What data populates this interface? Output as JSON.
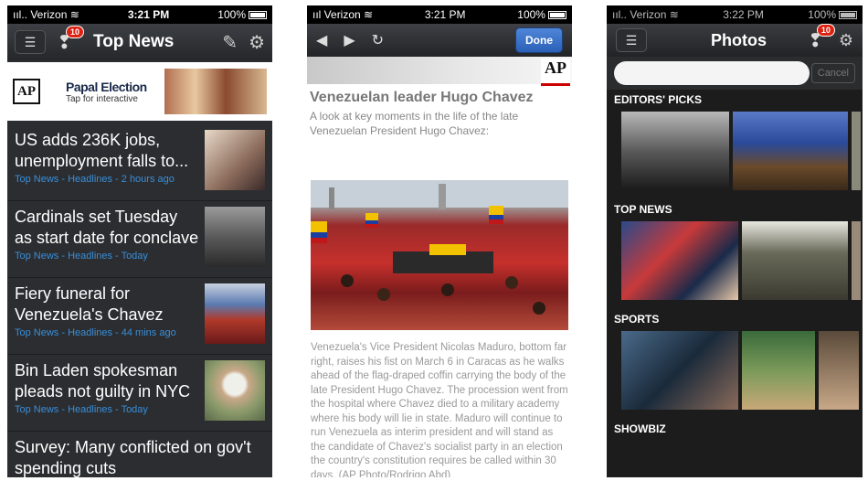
{
  "status": {
    "carrier": "Verizon",
    "time": "3:21 PM",
    "time3": "3:22 PM",
    "battery": "100%"
  },
  "news": {
    "title": "Top News",
    "badge": "10",
    "banner": {
      "logo": "AP",
      "title": "Papal Election",
      "subtitle": "Tap for interactive"
    },
    "stories": [
      {
        "headline": "US adds 236K jobs, unemployment falls to...",
        "meta": "Top News - Headlines - 2 hours ago"
      },
      {
        "headline": "Cardinals set Tuesday as start date for conclave",
        "meta": "Top News - Headlines - Today"
      },
      {
        "headline": "Fiery funeral for Venezuela's Chavez",
        "meta": "Top News - Headlines - 44 mins ago"
      },
      {
        "headline": "Bin Laden spokesman pleads not guilty in NYC",
        "meta": "Top News - Headlines - Today"
      },
      {
        "headline": "Survey: Many conflicted on gov't spending cuts",
        "meta": ""
      }
    ]
  },
  "article": {
    "done_label": "Done",
    "logo": "AP",
    "title": "Venezuelan leader Hugo Chavez",
    "subtitle": "A look at key moments in the life of the late Venezuelan President Hugo Chavez:",
    "caption": "Venezuela's Vice President Nicolas Maduro, bottom far right, raises his fist on March 6 in Caracas as he walks ahead of the flag-draped coffin carrying the body of the late President Hugo Chavez. The procession went from the hospital where Chavez died to a military academy where his body will lie in state. Maduro will continue to run Venezuela as interim president and will stand as the candidate of Chavez's socialist party in an election the country's constitution requires be called within 30 days. (AP Photo/Rodrigo Abd)"
  },
  "photos": {
    "title": "Photos",
    "badge": "10",
    "search_placeholder": "",
    "cancel_label": "Cancel",
    "sections": [
      {
        "label": "EDITORS' PICKS"
      },
      {
        "label": "TOP NEWS"
      },
      {
        "label": "SPORTS"
      },
      {
        "label": "SHOWBIZ"
      }
    ]
  },
  "colors": {
    "meta_blue": "#3a8ed8",
    "done_blue": "#2b60b8",
    "badge_red": "#dd2211"
  },
  "icons": [
    "menu-icon",
    "alert-icon",
    "compose-icon",
    "gear-icon",
    "back-arrow-icon",
    "forward-arrow-icon",
    "refresh-icon",
    "wifi-icon",
    "battery-icon"
  ]
}
